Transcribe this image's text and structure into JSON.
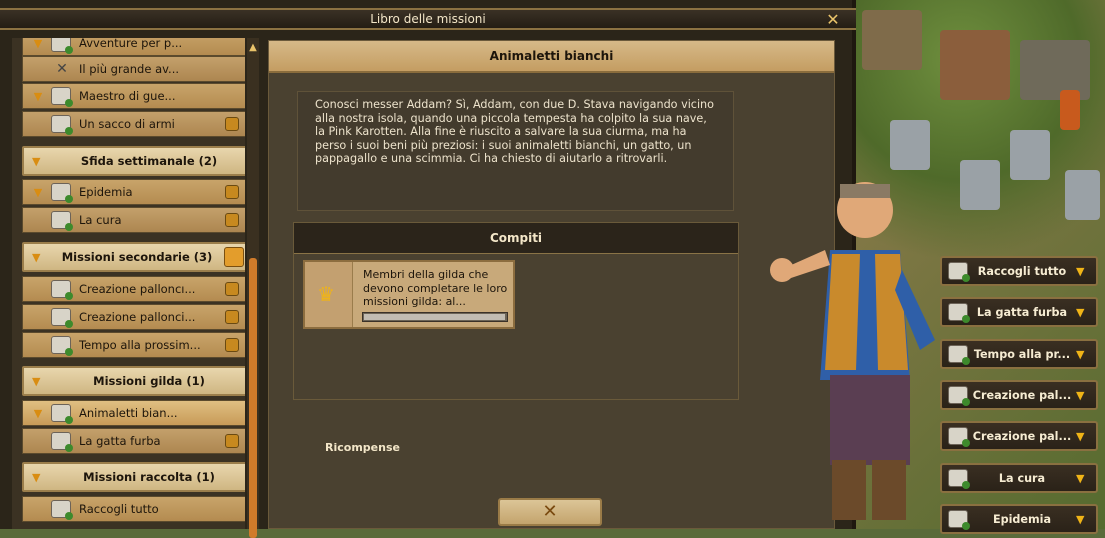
{
  "window": {
    "title": "Libro delle missioni",
    "close_icon": "close-icon"
  },
  "list": {
    "rows": [
      {
        "type": "row",
        "label": "Avventure per p...",
        "icon": "scroll-icon",
        "expanded": true
      },
      {
        "type": "row",
        "label": "Il più grande av...",
        "icon": "crossed-swords-icon",
        "sub": true
      },
      {
        "type": "row",
        "label": "Maestro di gue...",
        "icon": "scroll-icon",
        "expanded": true
      },
      {
        "type": "row",
        "label": "Un sacco di armi",
        "icon": "scroll-icon",
        "sub": true,
        "lock": true
      },
      {
        "type": "header",
        "label": "Sfida settimanale (2)"
      },
      {
        "type": "row",
        "label": "Epidemia",
        "icon": "scroll-icon",
        "expanded": true,
        "lock": true
      },
      {
        "type": "row",
        "label": "La cura",
        "icon": "scroll-icon",
        "sub": true,
        "lock": true
      },
      {
        "type": "header",
        "label": "Missioni secondarie (3)",
        "extra": true
      },
      {
        "type": "row",
        "label": "Creazione palloncı...",
        "icon": "scroll-icon",
        "lock": true
      },
      {
        "type": "row",
        "label": "Creazione pallonci...",
        "icon": "scroll-icon",
        "lock": true
      },
      {
        "type": "row",
        "label": "Tempo alla prossim...",
        "icon": "scroll-icon",
        "lock": true
      },
      {
        "type": "header",
        "label": "Missioni gilda (1)"
      },
      {
        "type": "row",
        "label": "Animaletti bian...",
        "icon": "scroll-icon",
        "expanded": true,
        "selected": true
      },
      {
        "type": "row",
        "label": "La gatta furba",
        "icon": "scroll-icon",
        "sub": true,
        "lock": true
      },
      {
        "type": "header",
        "label": "Missioni raccolta (1)"
      },
      {
        "type": "row",
        "label": "Raccogli tutto",
        "icon": "scroll-icon"
      }
    ]
  },
  "mission": {
    "title": "Animaletti bianchi",
    "description": "Conosci messer Addam? Sì, Addam, con due D. Stava navigando vicino alla nostra isola, quando una piccola tempesta ha colpito la sua nave, la Pink Karotten. Alla fine è riuscito a salvare la sua ciurma, ma ha perso i suoi beni più preziosi: i suoi animaletti bianchi, un gatto, un pappagallo e una scimmia. Ci ha chiesto di aiutarlo a ritrovarli.",
    "tasks_title": "Compiti",
    "task": {
      "text": "Membri della gilda che devono completare le loro missioni gilda: al...",
      "icon": "crown-icon",
      "progress": 0.99
    },
    "rewards_label": "Ricompense"
  },
  "quick_buttons": [
    {
      "label": "Raccogli tutto"
    },
    {
      "label": "La gatta furba"
    },
    {
      "label": "Tempo alla pr..."
    },
    {
      "label": "Creazione pal..."
    },
    {
      "label": "Creazione pal..."
    },
    {
      "label": "La cura"
    },
    {
      "label": "Epidemia"
    }
  ],
  "colors": {
    "accent": "#d98d12",
    "frame": "#8c7242",
    "panel": "#4a4130"
  }
}
